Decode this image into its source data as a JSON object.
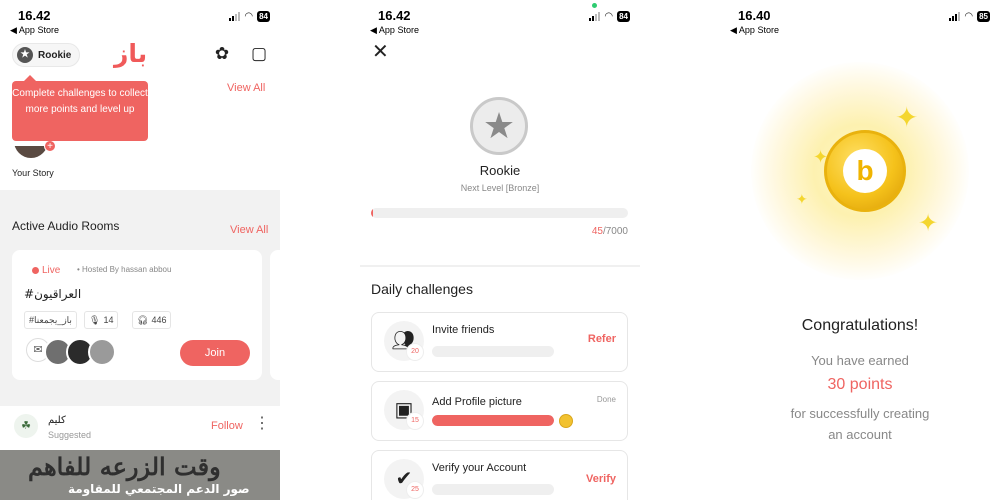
{
  "screens": {
    "home": {
      "status": {
        "time": "16.42",
        "back": "◀ App Store",
        "battery": "84"
      },
      "header": {
        "rank_label": "Rookie",
        "logo_text": "باز"
      },
      "tooltip": {
        "text": "Complete challenges to collect more points and level up"
      },
      "stories": {
        "view_all": "View All",
        "your_story": "Your Story"
      },
      "audio_rooms": {
        "title": "Active Audio Rooms",
        "view_all": "View All",
        "room": {
          "live": "Live",
          "hosted_by": "• Hosted By hassan abbou",
          "title": "#العراقيون",
          "tag": "#باز_يجمعنا",
          "mics": "14",
          "listeners": "446",
          "join": "Join"
        }
      },
      "post": {
        "name": "كليم",
        "sub": "Suggested",
        "follow": "Follow",
        "image_line1": "وقت الزرعه للفاهم",
        "image_line2": "صور الدعم المجتمعي للمقاومة"
      }
    },
    "challenges": {
      "status": {
        "time": "16.42",
        "back": "◀ App Store",
        "battery": "84"
      },
      "rank": "Rookie",
      "next_level": "Next Level [Bronze]",
      "progress": {
        "current": "45",
        "total": "/7000",
        "fraction": 0.0064
      },
      "daily_title": "Daily challenges",
      "items": [
        {
          "label": "Invite friends",
          "points": "20",
          "action": "Refer",
          "progress": 0
        },
        {
          "label": "Add Profile picture",
          "points": "15",
          "done": "Done",
          "progress": 1
        },
        {
          "label": "Verify your Account",
          "points": "25",
          "action": "Verify",
          "progress": 0
        }
      ]
    },
    "reward": {
      "status": {
        "time": "16.40",
        "back": "◀ App Store",
        "battery": "85"
      },
      "title": "Congratulations!",
      "earned": "You have earned",
      "points": "30 points",
      "reason_line1": "for successfully creating",
      "reason_line2": "an account"
    }
  },
  "colors": {
    "accent": "#ef6461",
    "gold": "#f5c21b"
  }
}
